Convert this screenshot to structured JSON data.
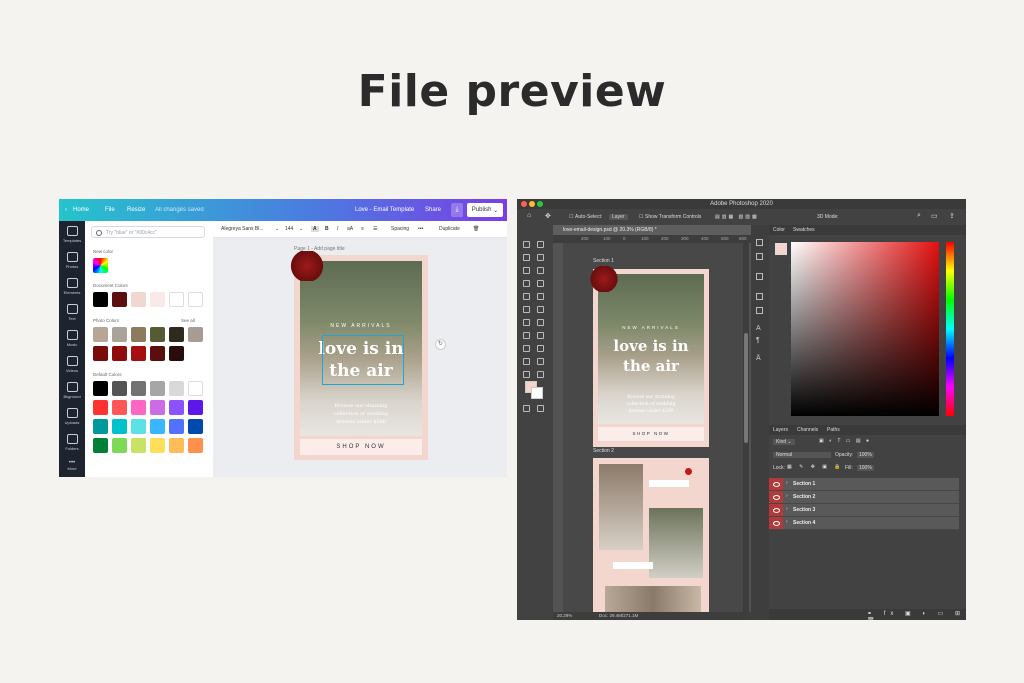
{
  "heading": "File preview",
  "canva": {
    "topbar": {
      "home": "Home",
      "file": "File",
      "resize": "Resize",
      "saved": "All changes saved",
      "doc_title": "Love - Email Template",
      "share": "Share",
      "publish": "Publish"
    },
    "rail": [
      "Templates",
      "Photos",
      "Elements",
      "Text",
      "Music",
      "Videos",
      "Bkground",
      "Uploads",
      "Folders",
      "More"
    ],
    "search_placeholder": "Try \"blue\" or \"#00c4cc\"",
    "sections": {
      "new_color": "New color",
      "document_colors": "Document Colors",
      "photo_colors": "Photo Colors",
      "see_all": "See all",
      "default_colors": "Default Colors"
    },
    "document_colors": [
      "#000000",
      "#5b0f0f",
      "#f0d8d0",
      "#fbe9ea",
      "#ffffff",
      "#ffffff"
    ],
    "photo_colors": [
      "#b7a596",
      "#a9a39a",
      "#8c7b5d",
      "#555c35",
      "#2e2b1e",
      "#a79b94",
      "#7a0b0b",
      "#8e0c0c",
      "#a50f0f",
      "#5a0e0e",
      "#2a0c0c"
    ],
    "default_colors": [
      "#000000",
      "#545454",
      "#737373",
      "#a6a6a6",
      "#d9d9d9",
      "#ffffff",
      "#ff3131",
      "#ff5757",
      "#ff66c4",
      "#cb6ce6",
      "#8c52ff",
      "#5e17eb",
      "#03989e",
      "#00c2cb",
      "#5ce1e6",
      "#38b6ff",
      "#5271ff",
      "#004aad",
      "#008037",
      "#7ed957",
      "#c9e265",
      "#ffde59",
      "#ffbd59",
      "#ff914d"
    ],
    "toolbar": {
      "font": "Alegreya Sans Bl...",
      "size": "144",
      "spacing": "Spacing",
      "duplicate": "Duplicate"
    },
    "page_label": "Page 1 - Add page title",
    "design": {
      "eyebrow": "NEW ARRIVALS",
      "headline1": "love is in",
      "headline2": "the air",
      "body1": "Browse our stunning",
      "body2": "collection of wedding",
      "body3": "dresses under $200",
      "cta": "SHOP NOW"
    }
  },
  "photoshop": {
    "app_title": "Adobe Photoshop 2020",
    "options": {
      "auto_select": "Auto-Select:",
      "layer": "Layer",
      "transform": "Show Transform Controls",
      "mode3d": "3D Mode:"
    },
    "doc_tab": "love-email-design.psd @ 20.3% (RGB/8) *",
    "ruler": [
      "200",
      "100",
      "0",
      "100",
      "200",
      "300",
      "400",
      "500",
      "600",
      "700",
      "800",
      "900",
      "1000",
      "1100",
      "1200",
      "1300",
      "1400",
      "1500",
      "1600"
    ],
    "section1": "Section 1",
    "section2": "Section 2",
    "art": {
      "eyebrow": "NEW ARRIVALS",
      "headline1": "love is in",
      "headline2": "the air",
      "body1": "Browse our stunning",
      "body2": "collection of wedding",
      "body3": "dresses under $200",
      "cta": "SHOP NOW"
    },
    "status": {
      "zoom": "20.29%",
      "doc": "Doc: 29.4M/271.1M"
    },
    "color_tabs": {
      "color": "Color",
      "swatches": "Swatches"
    },
    "layer_tabs": {
      "layers": "Layers",
      "channels": "Channels",
      "paths": "Paths"
    },
    "layer_controls": {
      "kind": "Kind",
      "blend": "Normal",
      "opacity_label": "Opacity:",
      "opacity": "100%",
      "lock": "Lock:",
      "fill_label": "Fill:",
      "fill": "100%"
    },
    "layers": [
      "Section 1",
      "Section 2",
      "Section 3",
      "Section 4"
    ]
  }
}
